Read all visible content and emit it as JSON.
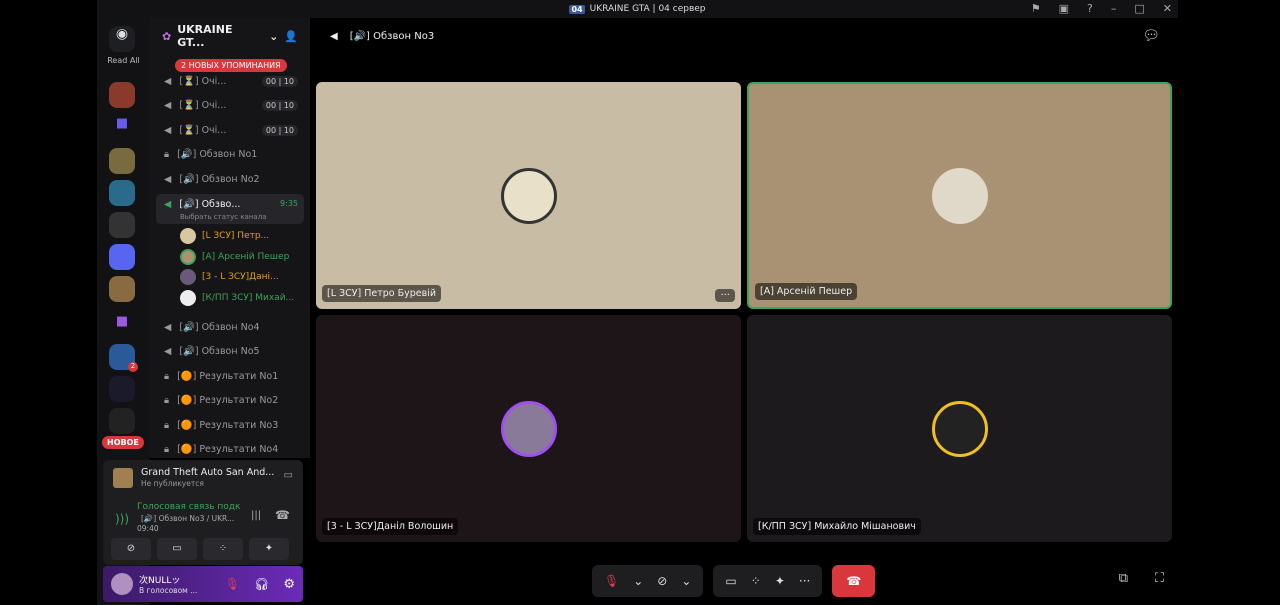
{
  "window": {
    "title": "UKRAINE GTA | 04 сервер",
    "logo": "04"
  },
  "rail": {
    "read_all": "Read All",
    "new_badge": "НОВОЕ",
    "mention_count": "2"
  },
  "server": {
    "name": "UKRAINE GT...",
    "mentions_badge": "2 НОВЫХ УПОМИНАНИЯ"
  },
  "channels": [
    {
      "icon": "speaker-icon",
      "label": "[⏳] Очі...",
      "count": "00 | 10"
    },
    {
      "icon": "speaker-icon",
      "label": "[⏳] Очі...",
      "count": "00 | 10"
    },
    {
      "icon": "speaker-icon",
      "label": "[⏳] Очі...",
      "count": "00 | 10"
    },
    {
      "icon": "lock-icon",
      "label": "[🔊] Обзвон No1"
    },
    {
      "icon": "speaker-icon",
      "label": "[🔊] Обзвон No2"
    },
    {
      "icon": "speaker-active-icon",
      "label": "[🔊] Обзво...",
      "time": "9:35",
      "status": "Выбрать статус канала"
    },
    {
      "icon": "speaker-icon",
      "label": "[🔊] Обзвон No4"
    },
    {
      "icon": "speaker-icon",
      "label": "[🔊] Обзвон No5"
    },
    {
      "icon": "lock-icon",
      "label": "[🟠] Результати No1"
    },
    {
      "icon": "lock-icon",
      "label": "[🟠] Результати No2"
    },
    {
      "icon": "lock-icon",
      "label": "[🟠] Результати No3"
    },
    {
      "icon": "lock-icon",
      "label": "[🟠] Результати No4"
    }
  ],
  "voice_users": [
    {
      "name": "[L ЗСУ] Петр...",
      "color": "#e0a020"
    },
    {
      "name": "[A] Арсеній Пешер",
      "color": "#3ba55d"
    },
    {
      "name": "[3 - L ЗСУ]Дані...",
      "color": "#e0a020"
    },
    {
      "name": "[К/ПП ЗСУ] Михай...",
      "color": "#3ba55d"
    }
  ],
  "activity": {
    "game": "Grand Theft Auto San And...",
    "sub": "Не публикуется"
  },
  "voice": {
    "status": "Голосовая связь подк",
    "channel": "[🔊] Обзвон No3 / UKR...",
    "time": "09:40"
  },
  "me": {
    "name": "次NULLッ",
    "status": "В голосовом ..."
  },
  "header": {
    "channel": "[🔊] Обзвон No3"
  },
  "tiles": [
    {
      "name": "[L ЗСУ] Петро Буревій",
      "bg": "#c9bca5"
    },
    {
      "name": "[A] Арсеній Пешер",
      "bg": "#a89273"
    },
    {
      "name": "[3 - L ЗСУ]Даніл Волошин",
      "bg": "#1d1518"
    },
    {
      "name": "[К/ПП ЗСУ] Михайло Мішанович",
      "bg": "#1c1a1c"
    }
  ]
}
